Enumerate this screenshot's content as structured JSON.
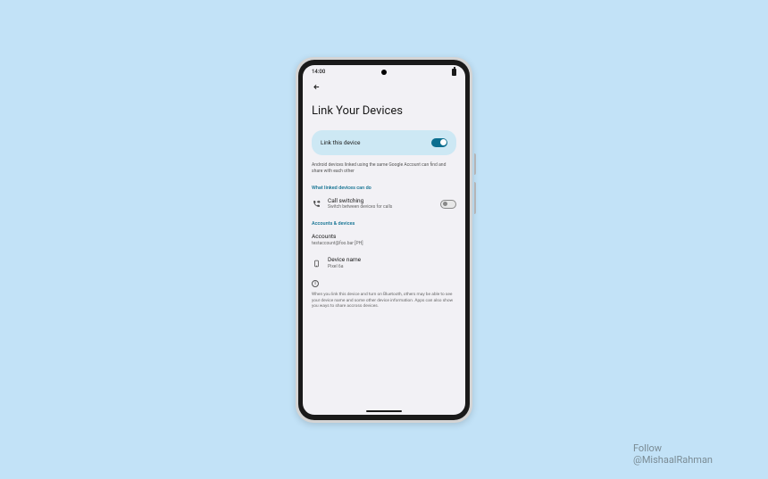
{
  "statusBar": {
    "time": "14:00"
  },
  "page": {
    "title": "Link Your Devices",
    "linkCard": {
      "label": "Link this device",
      "toggled": true
    },
    "description": "Android devices linked using the same Google Account can find and share with each other"
  },
  "sections": {
    "capabilities": {
      "header": "What linked devices can do",
      "callSwitching": {
        "title": "Call switching",
        "subtitle": "Switch between devices for calls",
        "toggled": false
      }
    },
    "accounts": {
      "header": "Accounts & devices",
      "account": {
        "title": "Accounts",
        "value": "testaccount@foo.bar [PH]"
      },
      "device": {
        "title": "Device name",
        "value": "Pixel 6a"
      }
    }
  },
  "disclaimer": "When you link this device and turn on Bluetooth, others may be able to see your device name and some other device information. Apps can also show you ways to share accross devices.",
  "credit": {
    "line1": "Follow",
    "line2": "@MishaalRahman"
  }
}
